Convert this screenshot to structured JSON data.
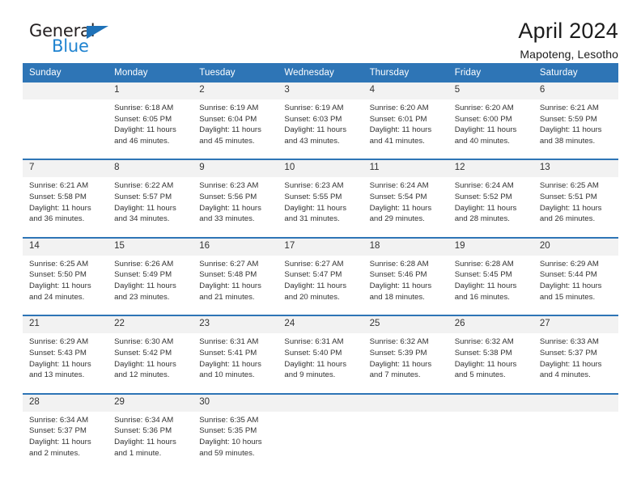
{
  "brand": {
    "name_top": "General",
    "name_bottom": "Blue",
    "triangle_color": "#1f72b8",
    "text_color": "#231f20",
    "blue_color": "#1f83d0"
  },
  "header": {
    "title": "April 2024",
    "subtitle": "Mapoteng, Lesotho"
  },
  "theme": {
    "header_bg": "#2e75b6",
    "header_text": "#ffffff",
    "daynum_bg": "#f2f2f2",
    "cell_bg": "#ffffff",
    "body_text": "#333333"
  },
  "weekdays": [
    "Sunday",
    "Monday",
    "Tuesday",
    "Wednesday",
    "Thursday",
    "Friday",
    "Saturday"
  ],
  "weeks": [
    {
      "days": [
        {
          "num": "",
          "lines": []
        },
        {
          "num": "1",
          "lines": [
            "Sunrise: 6:18 AM",
            "Sunset: 6:05 PM",
            "Daylight: 11 hours",
            "and 46 minutes."
          ]
        },
        {
          "num": "2",
          "lines": [
            "Sunrise: 6:19 AM",
            "Sunset: 6:04 PM",
            "Daylight: 11 hours",
            "and 45 minutes."
          ]
        },
        {
          "num": "3",
          "lines": [
            "Sunrise: 6:19 AM",
            "Sunset: 6:03 PM",
            "Daylight: 11 hours",
            "and 43 minutes."
          ]
        },
        {
          "num": "4",
          "lines": [
            "Sunrise: 6:20 AM",
            "Sunset: 6:01 PM",
            "Daylight: 11 hours",
            "and 41 minutes."
          ]
        },
        {
          "num": "5",
          "lines": [
            "Sunrise: 6:20 AM",
            "Sunset: 6:00 PM",
            "Daylight: 11 hours",
            "and 40 minutes."
          ]
        },
        {
          "num": "6",
          "lines": [
            "Sunrise: 6:21 AM",
            "Sunset: 5:59 PM",
            "Daylight: 11 hours",
            "and 38 minutes."
          ]
        }
      ]
    },
    {
      "days": [
        {
          "num": "7",
          "lines": [
            "Sunrise: 6:21 AM",
            "Sunset: 5:58 PM",
            "Daylight: 11 hours",
            "and 36 minutes."
          ]
        },
        {
          "num": "8",
          "lines": [
            "Sunrise: 6:22 AM",
            "Sunset: 5:57 PM",
            "Daylight: 11 hours",
            "and 34 minutes."
          ]
        },
        {
          "num": "9",
          "lines": [
            "Sunrise: 6:23 AM",
            "Sunset: 5:56 PM",
            "Daylight: 11 hours",
            "and 33 minutes."
          ]
        },
        {
          "num": "10",
          "lines": [
            "Sunrise: 6:23 AM",
            "Sunset: 5:55 PM",
            "Daylight: 11 hours",
            "and 31 minutes."
          ]
        },
        {
          "num": "11",
          "lines": [
            "Sunrise: 6:24 AM",
            "Sunset: 5:54 PM",
            "Daylight: 11 hours",
            "and 29 minutes."
          ]
        },
        {
          "num": "12",
          "lines": [
            "Sunrise: 6:24 AM",
            "Sunset: 5:52 PM",
            "Daylight: 11 hours",
            "and 28 minutes."
          ]
        },
        {
          "num": "13",
          "lines": [
            "Sunrise: 6:25 AM",
            "Sunset: 5:51 PM",
            "Daylight: 11 hours",
            "and 26 minutes."
          ]
        }
      ]
    },
    {
      "days": [
        {
          "num": "14",
          "lines": [
            "Sunrise: 6:25 AM",
            "Sunset: 5:50 PM",
            "Daylight: 11 hours",
            "and 24 minutes."
          ]
        },
        {
          "num": "15",
          "lines": [
            "Sunrise: 6:26 AM",
            "Sunset: 5:49 PM",
            "Daylight: 11 hours",
            "and 23 minutes."
          ]
        },
        {
          "num": "16",
          "lines": [
            "Sunrise: 6:27 AM",
            "Sunset: 5:48 PM",
            "Daylight: 11 hours",
            "and 21 minutes."
          ]
        },
        {
          "num": "17",
          "lines": [
            "Sunrise: 6:27 AM",
            "Sunset: 5:47 PM",
            "Daylight: 11 hours",
            "and 20 minutes."
          ]
        },
        {
          "num": "18",
          "lines": [
            "Sunrise: 6:28 AM",
            "Sunset: 5:46 PM",
            "Daylight: 11 hours",
            "and 18 minutes."
          ]
        },
        {
          "num": "19",
          "lines": [
            "Sunrise: 6:28 AM",
            "Sunset: 5:45 PM",
            "Daylight: 11 hours",
            "and 16 minutes."
          ]
        },
        {
          "num": "20",
          "lines": [
            "Sunrise: 6:29 AM",
            "Sunset: 5:44 PM",
            "Daylight: 11 hours",
            "and 15 minutes."
          ]
        }
      ]
    },
    {
      "days": [
        {
          "num": "21",
          "lines": [
            "Sunrise: 6:29 AM",
            "Sunset: 5:43 PM",
            "Daylight: 11 hours",
            "and 13 minutes."
          ]
        },
        {
          "num": "22",
          "lines": [
            "Sunrise: 6:30 AM",
            "Sunset: 5:42 PM",
            "Daylight: 11 hours",
            "and 12 minutes."
          ]
        },
        {
          "num": "23",
          "lines": [
            "Sunrise: 6:31 AM",
            "Sunset: 5:41 PM",
            "Daylight: 11 hours",
            "and 10 minutes."
          ]
        },
        {
          "num": "24",
          "lines": [
            "Sunrise: 6:31 AM",
            "Sunset: 5:40 PM",
            "Daylight: 11 hours",
            "and 9 minutes."
          ]
        },
        {
          "num": "25",
          "lines": [
            "Sunrise: 6:32 AM",
            "Sunset: 5:39 PM",
            "Daylight: 11 hours",
            "and 7 minutes."
          ]
        },
        {
          "num": "26",
          "lines": [
            "Sunrise: 6:32 AM",
            "Sunset: 5:38 PM",
            "Daylight: 11 hours",
            "and 5 minutes."
          ]
        },
        {
          "num": "27",
          "lines": [
            "Sunrise: 6:33 AM",
            "Sunset: 5:37 PM",
            "Daylight: 11 hours",
            "and 4 minutes."
          ]
        }
      ]
    },
    {
      "days": [
        {
          "num": "28",
          "lines": [
            "Sunrise: 6:34 AM",
            "Sunset: 5:37 PM",
            "Daylight: 11 hours",
            "and 2 minutes."
          ]
        },
        {
          "num": "29",
          "lines": [
            "Sunrise: 6:34 AM",
            "Sunset: 5:36 PM",
            "Daylight: 11 hours",
            "and 1 minute."
          ]
        },
        {
          "num": "30",
          "lines": [
            "Sunrise: 6:35 AM",
            "Sunset: 5:35 PM",
            "Daylight: 10 hours",
            "and 59 minutes."
          ]
        },
        {
          "num": "",
          "lines": []
        },
        {
          "num": "",
          "lines": []
        },
        {
          "num": "",
          "lines": []
        },
        {
          "num": "",
          "lines": []
        }
      ]
    }
  ]
}
